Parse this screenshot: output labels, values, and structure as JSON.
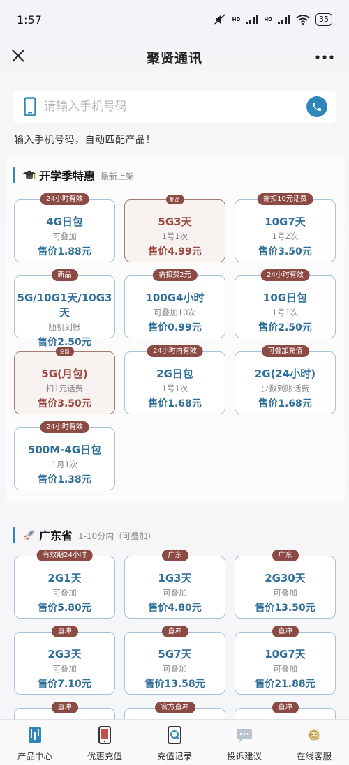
{
  "status": {
    "time": "1:57",
    "battery": "35",
    "hd1": "HD",
    "hd2": "HD"
  },
  "nav": {
    "title": "聚贤通讯"
  },
  "search": {
    "placeholder": "请输入手机号码",
    "hint": "输入手机号码，自动匹配产品！"
  },
  "sections": [
    {
      "title": "开学季特惠",
      "subtitle": "最新上架"
    },
    {
      "title": "广东省",
      "subtitle": "1-10分内（可叠加)"
    }
  ],
  "cards": [
    {
      "badge": "24小时有效",
      "name": "4G日包",
      "desc": "可叠加",
      "price": "售价1.88元"
    },
    {
      "badge": "新品",
      "name": "5G3天",
      "desc": "1号1次",
      "price": "售价4.99元"
    },
    {
      "badge": "需扣10元话费",
      "name": "10G7天",
      "desc": "1号2次",
      "price": "售价3.50元"
    },
    {
      "badge": "新品",
      "name": "5G/10G1天/10G3天",
      "desc": "随机到账",
      "price": "售价2.50元"
    },
    {
      "badge": "需扣费2元",
      "name": "100G4小时",
      "desc": "可叠加10次",
      "price": "售价0.99元"
    },
    {
      "badge": "24小时有效",
      "name": "10G日包",
      "desc": "1号1次",
      "price": "售价2.50元"
    },
    {
      "badge": "全国",
      "name": "5G(月包)",
      "desc": "扣1元话费",
      "price": "售价3.50元"
    },
    {
      "badge": "24小时内有效",
      "name": "2G日包",
      "desc": "1号1次",
      "price": "售价1.68元"
    },
    {
      "badge": "可叠加充值",
      "name": "2G(24小时)",
      "desc": "少数到账话费",
      "price": "售价1.68元"
    },
    {
      "badge": "24小时有效",
      "name": "500M-4G日包",
      "desc": "1月1次",
      "price": "售价1.38元"
    },
    {
      "badge": "有效期24小时",
      "name": "2G1天",
      "desc": "可叠加",
      "price": "售价5.80元"
    },
    {
      "badge": "广东",
      "name": "1G3天",
      "desc": "可叠加",
      "price": "售价4.80元"
    },
    {
      "badge": "广东",
      "name": "2G30天",
      "desc": "可叠加",
      "price": "售价13.50元"
    },
    {
      "badge": "直冲",
      "name": "2G3天",
      "desc": "可叠加",
      "price": "售价7.10元"
    },
    {
      "badge": "直冲",
      "name": "5G7天",
      "desc": "可叠加",
      "price": "售价13.58元"
    },
    {
      "badge": "直冲",
      "name": "10G7天",
      "desc": "可叠加",
      "price": "售价21.88元"
    },
    {
      "badge": "直冲",
      "name": "",
      "desc": "",
      "price": ""
    },
    {
      "badge": "官方直冲",
      "name": "",
      "desc": "",
      "price": ""
    },
    {
      "badge": "直冲",
      "name": "",
      "desc": "",
      "price": ""
    }
  ],
  "tabs": [
    {
      "label": "产品中心",
      "icon": "product-center-icon"
    },
    {
      "label": "优惠充值",
      "icon": "discount-recharge-icon"
    },
    {
      "label": "充值记录",
      "icon": "recharge-record-icon"
    },
    {
      "label": "投诉建议",
      "icon": "complaint-icon"
    },
    {
      "label": "在线客服",
      "icon": "online-service-icon"
    }
  ],
  "colors": {
    "accent": "#2f86b8",
    "badge": "#8c4a44",
    "price_blue": "#2f6f9a",
    "price_red": "#9b4943"
  }
}
